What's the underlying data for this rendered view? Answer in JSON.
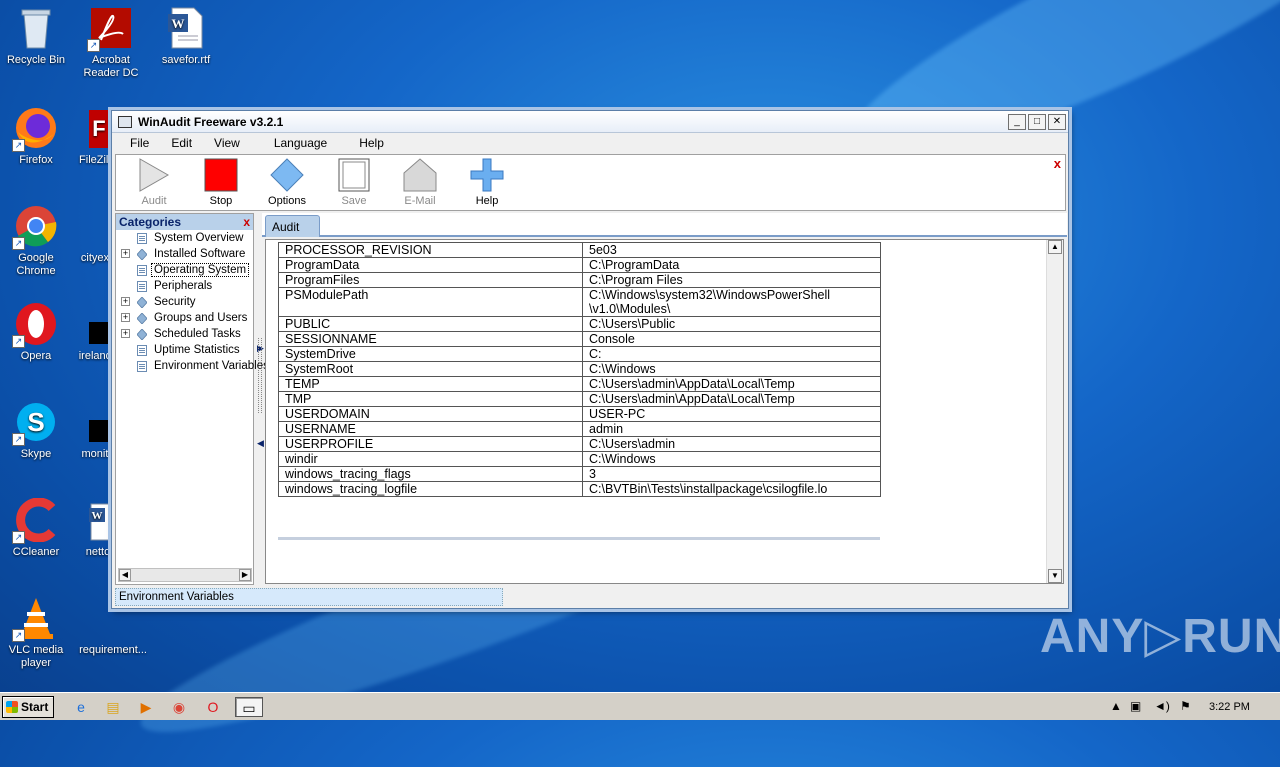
{
  "desktop": {
    "icons": [
      {
        "id": "recycle",
        "label": "Recycle Bin",
        "icon": "recycle-bin-icon"
      },
      {
        "id": "acrobat",
        "label": "Acrobat Reader DC",
        "icon": "acrobat-icon"
      },
      {
        "id": "savefor",
        "label": "savefor.rtf",
        "icon": "word-doc-icon"
      },
      {
        "id": "firefox",
        "label": "Firefox",
        "icon": "firefox-icon"
      },
      {
        "id": "filezilla",
        "label": "FileZilla",
        "icon": "filezilla-icon"
      },
      {
        "id": "chrome",
        "label": "Google Chrome",
        "icon": "chrome-icon"
      },
      {
        "id": "cityexp",
        "label": "cityexp",
        "icon": "file-icon"
      },
      {
        "id": "opera",
        "label": "Opera",
        "icon": "opera-icon"
      },
      {
        "id": "ireland",
        "label": "irelandy",
        "icon": "file-icon"
      },
      {
        "id": "skype",
        "label": "Skype",
        "icon": "skype-icon"
      },
      {
        "id": "monito",
        "label": "monito",
        "icon": "file-icon"
      },
      {
        "id": "ccleaner",
        "label": "CCleaner",
        "icon": "ccleaner-icon"
      },
      {
        "id": "netto",
        "label": "netto",
        "icon": "word-doc-icon"
      },
      {
        "id": "vlc",
        "label": "VLC media player",
        "icon": "vlc-icon"
      },
      {
        "id": "requirement",
        "label": "requirement...",
        "icon": "file-icon"
      }
    ]
  },
  "window": {
    "title": "WinAudit Freeware v3.2.1",
    "controls": {
      "minimize": "_",
      "maximize": "□",
      "close": "✕"
    }
  },
  "menu": [
    "File",
    "Edit",
    "View",
    "Language",
    "Help"
  ],
  "toolbar": {
    "buttons": [
      {
        "label": "Audit",
        "enabled": false
      },
      {
        "label": "Stop",
        "enabled": true
      },
      {
        "label": "Options",
        "enabled": true
      },
      {
        "label": "Save",
        "enabled": false
      },
      {
        "label": "E-Mail",
        "enabled": false
      },
      {
        "label": "Help",
        "enabled": true
      }
    ],
    "close": "x"
  },
  "categories": {
    "header": "Categories",
    "close": "x",
    "items": [
      {
        "label": "System Overview",
        "expandable": false,
        "icon": "page-icon"
      },
      {
        "label": "Installed Software",
        "expandable": true,
        "icon": "diamond-icon"
      },
      {
        "label": "Operating System",
        "expandable": false,
        "icon": "page-icon",
        "selected": true
      },
      {
        "label": "Peripherals",
        "expandable": false,
        "icon": "page-icon"
      },
      {
        "label": "Security",
        "expandable": true,
        "icon": "diamond-icon"
      },
      {
        "label": "Groups and Users",
        "expandable": true,
        "icon": "diamond-icon"
      },
      {
        "label": "Scheduled Tasks",
        "expandable": true,
        "icon": "diamond-icon"
      },
      {
        "label": "Uptime Statistics",
        "expandable": false,
        "icon": "page-icon"
      },
      {
        "label": "Environment Variables",
        "expandable": false,
        "icon": "page-icon"
      }
    ]
  },
  "tabs": [
    "Audit"
  ],
  "env_table": {
    "rows": [
      [
        "PROCESSOR_REVISION",
        "5e03"
      ],
      [
        "ProgramData",
        "C:\\ProgramData"
      ],
      [
        "ProgramFiles",
        "C:\\Program Files"
      ],
      [
        "PSModulePath",
        "C:\\Windows\\system32\\WindowsPowerShell\n\\v1.0\\Modules\\"
      ],
      [
        "PUBLIC",
        "C:\\Users\\Public"
      ],
      [
        "SESSIONNAME",
        "Console"
      ],
      [
        "SystemDrive",
        "C:"
      ],
      [
        "SystemRoot",
        "C:\\Windows"
      ],
      [
        "TEMP",
        "C:\\Users\\admin\\AppData\\Local\\Temp"
      ],
      [
        "TMP",
        "C:\\Users\\admin\\AppData\\Local\\Temp"
      ],
      [
        "USERDOMAIN",
        "USER-PC"
      ],
      [
        "USERNAME",
        "admin"
      ],
      [
        "USERPROFILE",
        "C:\\Users\\admin"
      ],
      [
        "windir",
        "C:\\Windows"
      ],
      [
        "windows_tracing_flags",
        "3"
      ],
      [
        "windows_tracing_logfile",
        "C:\\BVTBin\\Tests\\installpackage\\csilogfile.lo"
      ]
    ]
  },
  "statusbar": {
    "text": "Environment Variables"
  },
  "taskbar": {
    "start_label": "Start",
    "apps": [
      "ie-icon",
      "explorer-icon",
      "media-player-icon",
      "chrome-icon",
      "opera-icon",
      "winaudit-icon"
    ],
    "clock": "3:22 PM"
  },
  "watermark": "ANY▷RUN"
}
